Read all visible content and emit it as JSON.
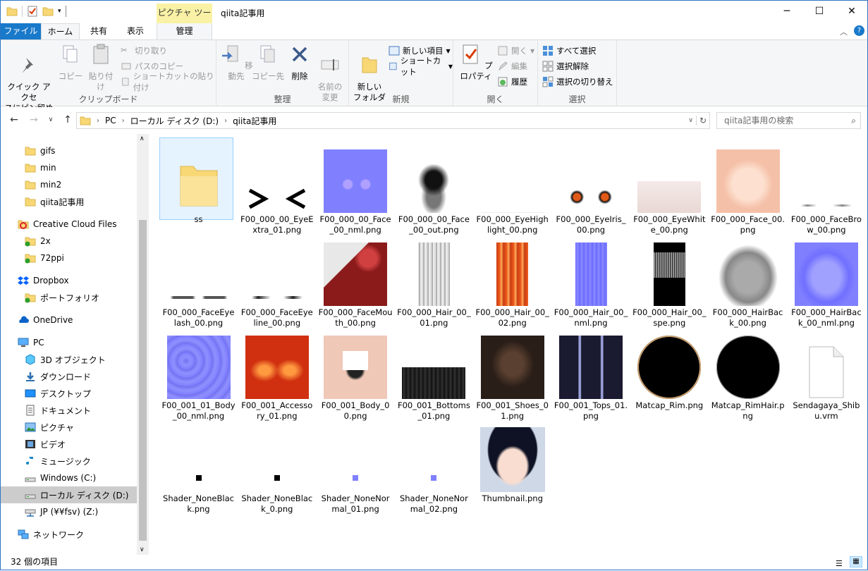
{
  "window": {
    "title": "qiita記事用",
    "context_tab_header": "ピクチャ ツール"
  },
  "tabs": {
    "file": "ファイル",
    "home": "ホーム",
    "share": "共有",
    "view": "表示",
    "manage": "管理"
  },
  "ribbon": {
    "clipboard": {
      "label": "クリップボード",
      "pin": "クイック アクセ\nスにピン留め",
      "copy": "コピー",
      "paste": "貼り付け",
      "cut": "切り取り",
      "copy_path": "パスのコピー",
      "paste_shortcut": "ショートカットの貼り付け"
    },
    "organize": {
      "label": "整理",
      "move_to": "移動先",
      "copy_to": "コピー先",
      "delete": "削除",
      "rename": "名前の\n変更"
    },
    "new": {
      "label": "新規",
      "new_folder": "新しい\nフォルダー",
      "new_item": "新しい項目",
      "easy_access": "ショートカット"
    },
    "open": {
      "label": "開く",
      "properties": "プロパティ",
      "open": "開く",
      "edit": "編集",
      "history": "履歴"
    },
    "select": {
      "label": "選択",
      "select_all": "すべて選択",
      "select_none": "選択解除",
      "invert": "選択の切り替え"
    }
  },
  "address": {
    "crumbs": [
      "PC",
      "ローカル ディスク (D:)",
      "qiita記事用"
    ],
    "search_placeholder": "qiita記事用の検索"
  },
  "nav": {
    "items": [
      {
        "label": "gifs"
      },
      {
        "label": "min"
      },
      {
        "label": "min2"
      },
      {
        "label": "qiita記事用"
      },
      {
        "label": "Creative Cloud Files"
      },
      {
        "label": "2x"
      },
      {
        "label": "72ppi"
      },
      {
        "label": "Dropbox"
      },
      {
        "label": "ポートフォリオ"
      },
      {
        "label": "OneDrive"
      },
      {
        "label": "PC"
      },
      {
        "label": "3D オブジェクト"
      },
      {
        "label": "ダウンロード"
      },
      {
        "label": "デスクトップ"
      },
      {
        "label": "ドキュメント"
      },
      {
        "label": "ピクチャ"
      },
      {
        "label": "ビデオ"
      },
      {
        "label": "ミュージック"
      },
      {
        "label": "Windows (C:)"
      },
      {
        "label": "ローカル ディスク (D:)"
      },
      {
        "label": "JP (¥¥fsv) (Z:)"
      },
      {
        "label": "ネットワーク"
      }
    ]
  },
  "files": [
    {
      "name": "ss"
    },
    {
      "name": "F00_000_00_EyeExtra_01.png"
    },
    {
      "name": "F00_000_00_Face_00_nml.png"
    },
    {
      "name": "F00_000_00_Face_00_out.png"
    },
    {
      "name": "F00_000_EyeHighlight_00.png"
    },
    {
      "name": "F00_000_EyeIris_00.png"
    },
    {
      "name": "F00_000_EyeWhite_00.png"
    },
    {
      "name": "F00_000_Face_00.png"
    },
    {
      "name": "F00_000_FaceBrow_00.png"
    },
    {
      "name": "F00_000_FaceEyelash_00.png"
    },
    {
      "name": "F00_000_FaceEyeline_00.png"
    },
    {
      "name": "F00_000_FaceMouth_00.png"
    },
    {
      "name": "F00_000_Hair_00_01.png"
    },
    {
      "name": "F00_000_Hair_00_02.png"
    },
    {
      "name": "F00_000_Hair_00_nml.png"
    },
    {
      "name": "F00_000_Hair_00_spe.png"
    },
    {
      "name": "F00_000_HairBack_00.png"
    },
    {
      "name": "F00_000_HairBack_00_nml.png"
    },
    {
      "name": "F00_001_01_Body_00_nml.png"
    },
    {
      "name": "F00_001_Accessory_01.png"
    },
    {
      "name": "F00_001_Body_00.png"
    },
    {
      "name": "F00_001_Bottoms_01.png"
    },
    {
      "name": "F00_001_Shoes_01.png"
    },
    {
      "name": "F00_001_Tops_01.png"
    },
    {
      "name": "Matcap_Rim.png"
    },
    {
      "name": "Matcap_RimHair.png"
    },
    {
      "name": "Sendagaya_Shibu.vrm"
    },
    {
      "name": "Shader_NoneBlack.png"
    },
    {
      "name": "Shader_NoneBlack_0.png"
    },
    {
      "name": "Shader_NoneNormal_01.png"
    },
    {
      "name": "Shader_NoneNormal_02.png"
    },
    {
      "name": "Thumbnail.png"
    }
  ],
  "status": {
    "count": "32 個の項目"
  },
  "colors": {
    "accent": "#1979ca",
    "context": "#f9f1a5",
    "normal_map": "#8080ff",
    "selection": "#cce8ff"
  }
}
